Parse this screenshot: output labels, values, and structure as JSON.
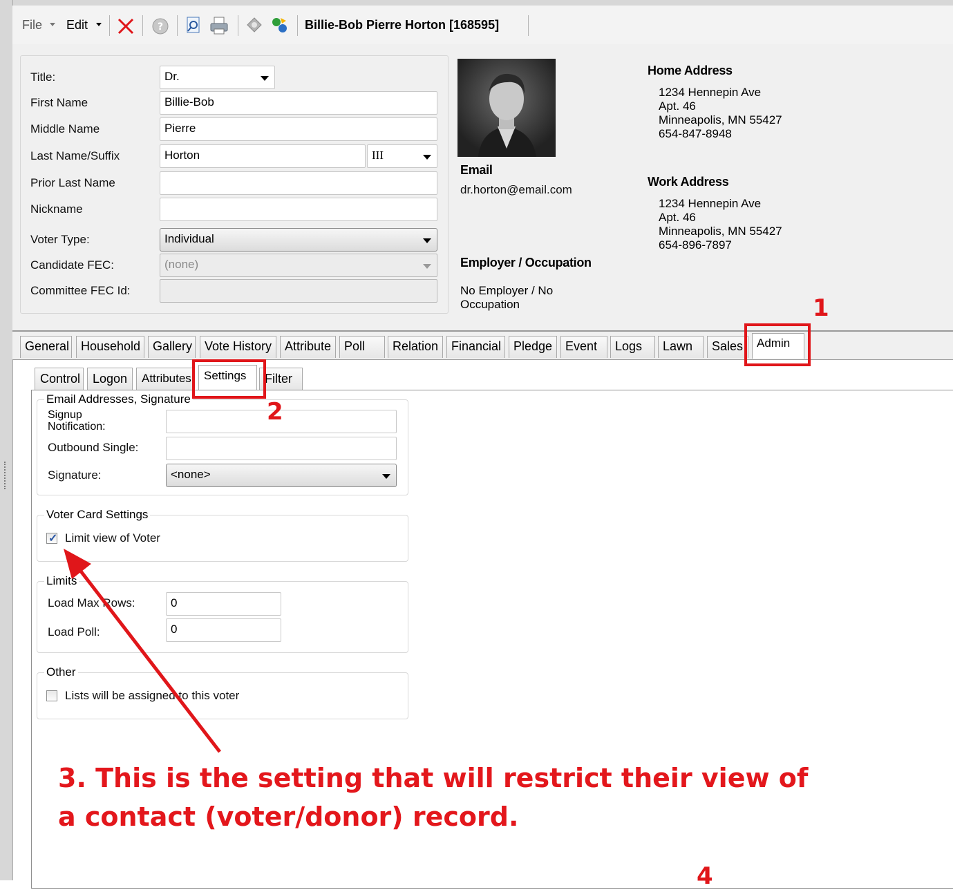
{
  "toolbar": {
    "file_label": "File",
    "edit_label": "Edit",
    "record_title": "Billie-Bob Pierre Horton [168595]",
    "icons": [
      "delete-icon",
      "help-icon",
      "search-document-icon",
      "print-icon",
      "tools-icon",
      "sync-icon"
    ]
  },
  "form": {
    "title_label": "Title:",
    "title_value": "Dr.",
    "first_name_label": "First Name",
    "first_name_value": "Billie-Bob",
    "middle_name_label": "Middle Name",
    "middle_name_value": "Pierre",
    "last_name_label": "Last Name/Suffix",
    "last_name_value": "Horton",
    "suffix_value": "III",
    "prior_last_name_label": "Prior Last Name",
    "prior_last_name_value": "",
    "nickname_label": "Nickname",
    "nickname_value": "",
    "voter_type_label": "Voter Type:",
    "voter_type_value": "Individual",
    "candidate_fec_label": "Candidate FEC:",
    "candidate_fec_value": "(none)",
    "committee_fec_label": "Committee FEC Id:",
    "committee_fec_value": ""
  },
  "contact": {
    "email_header": "Email",
    "email_value": "dr.horton@email.com",
    "employer_header": "Employer / Occupation",
    "employer_line1": "No Employer / No",
    "employer_line2": "Occupation"
  },
  "home_address": {
    "header": "Home Address",
    "line1": "1234 Hennepin Ave",
    "line2": "Apt. 46",
    "line3": "Minneapolis, MN 55427",
    "phone": "654-847-8948"
  },
  "work_address": {
    "header": "Work Address",
    "line1": "1234 Hennepin Ave",
    "line2": "Apt. 46",
    "line3": "Minneapolis, MN 55427",
    "phone": "654-896-7897"
  },
  "tabs": [
    "General",
    "Household",
    "Gallery",
    "Vote History",
    "Attribute",
    "Poll",
    "Relation",
    "Financial",
    "Pledge",
    "Event",
    "Logs",
    "Lawn",
    "Sales",
    "Admin"
  ],
  "active_tab": "Admin",
  "subtabs": [
    "Control",
    "Logon",
    "Attributes",
    "Settings",
    "Filter"
  ],
  "active_subtab": "Settings",
  "settings": {
    "email_group_title": "Email Addresses, Signature",
    "signup_label_1": "Signup",
    "signup_label_2": "Notification:",
    "signup_value": "",
    "outbound_label": "Outbound Single:",
    "outbound_value": "",
    "signature_label": "Signature:",
    "signature_value": "<none>",
    "voter_card_title": "Voter Card Settings",
    "limit_view_label": "Limit view of Voter",
    "limit_view_checked": true,
    "limits_title": "Limits",
    "load_max_rows_label": "Load Max Rows:",
    "load_max_rows_value": "0",
    "load_poll_label": "Load Poll:",
    "load_poll_value": "0",
    "other_title": "Other",
    "lists_label": "Lists will be assigned to this voter",
    "lists_checked": false
  },
  "annotations": {
    "num1": "1",
    "num2": "2",
    "num4": "4",
    "note_line1": "3. This is the setting that will restrict their view of",
    "note_line2": "a contact (voter/donor) record.",
    "color": "#e0161a"
  }
}
